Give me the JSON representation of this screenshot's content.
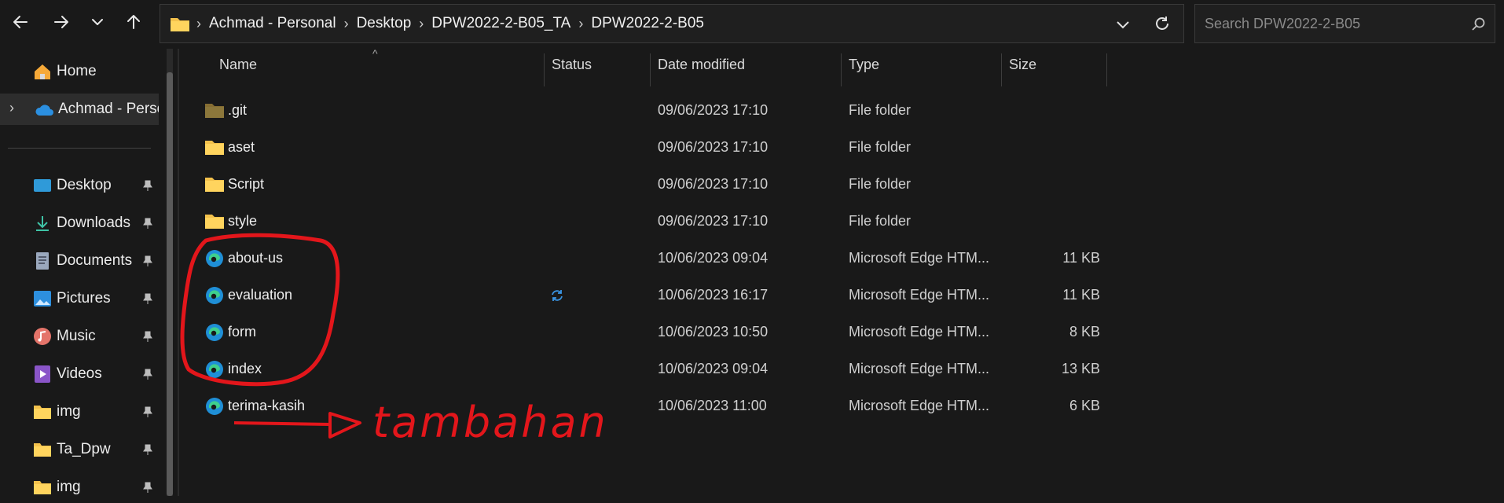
{
  "nav": {
    "back": "back-arrow",
    "forward": "forward-arrow",
    "recent": "chevron-down",
    "up": "up-arrow"
  },
  "address": {
    "crumbs": [
      "Achmad - Personal",
      "Desktop",
      "DPW2022-2-B05_TA",
      "DPW2022-2-B05"
    ]
  },
  "search": {
    "placeholder": "Search DPW2022-2-B05"
  },
  "sidebar": {
    "home": "Home",
    "onedrive": "Achmad - Personal",
    "quick": [
      {
        "label": "Desktop",
        "icon": "desktop-icon"
      },
      {
        "label": "Downloads",
        "icon": "download-icon"
      },
      {
        "label": "Documents",
        "icon": "documents-icon"
      },
      {
        "label": "Pictures",
        "icon": "pictures-icon"
      },
      {
        "label": "Music",
        "icon": "music-icon"
      },
      {
        "label": "Videos",
        "icon": "videos-icon"
      },
      {
        "label": "img",
        "icon": "folder-icon"
      },
      {
        "label": "Ta_Dpw",
        "icon": "folder-icon"
      },
      {
        "label": "img",
        "icon": "folder-icon"
      }
    ]
  },
  "columns": {
    "name": "Name",
    "status": "Status",
    "date": "Date modified",
    "type": "Type",
    "size": "Size"
  },
  "files": [
    {
      "name": ".git",
      "date": "09/06/2023 17:10",
      "type": "File folder",
      "size": "",
      "kind": "folder-hidden"
    },
    {
      "name": "aset",
      "date": "09/06/2023 17:10",
      "type": "File folder",
      "size": "",
      "kind": "folder"
    },
    {
      "name": "Script",
      "date": "09/06/2023 17:10",
      "type": "File folder",
      "size": "",
      "kind": "folder"
    },
    {
      "name": "style",
      "date": "09/06/2023 17:10",
      "type": "File folder",
      "size": "",
      "kind": "folder"
    },
    {
      "name": "about-us",
      "date": "10/06/2023 09:04",
      "type": "Microsoft Edge HTM...",
      "size": "11 KB",
      "kind": "edge"
    },
    {
      "name": "evaluation",
      "date": "10/06/2023 16:17",
      "type": "Microsoft Edge HTM...",
      "size": "11 KB",
      "kind": "edge",
      "status": "sync-icon"
    },
    {
      "name": "form",
      "date": "10/06/2023 10:50",
      "type": "Microsoft Edge HTM...",
      "size": "8 KB",
      "kind": "edge"
    },
    {
      "name": "index",
      "date": "10/06/2023 09:04",
      "type": "Microsoft Edge HTM...",
      "size": "13 KB",
      "kind": "edge"
    },
    {
      "name": "terima-kasih",
      "date": "10/06/2023 11:00",
      "type": "Microsoft Edge HTM...",
      "size": "6 KB",
      "kind": "edge"
    }
  ],
  "annotation": {
    "text": "tambahan",
    "color": "#e3161b"
  }
}
